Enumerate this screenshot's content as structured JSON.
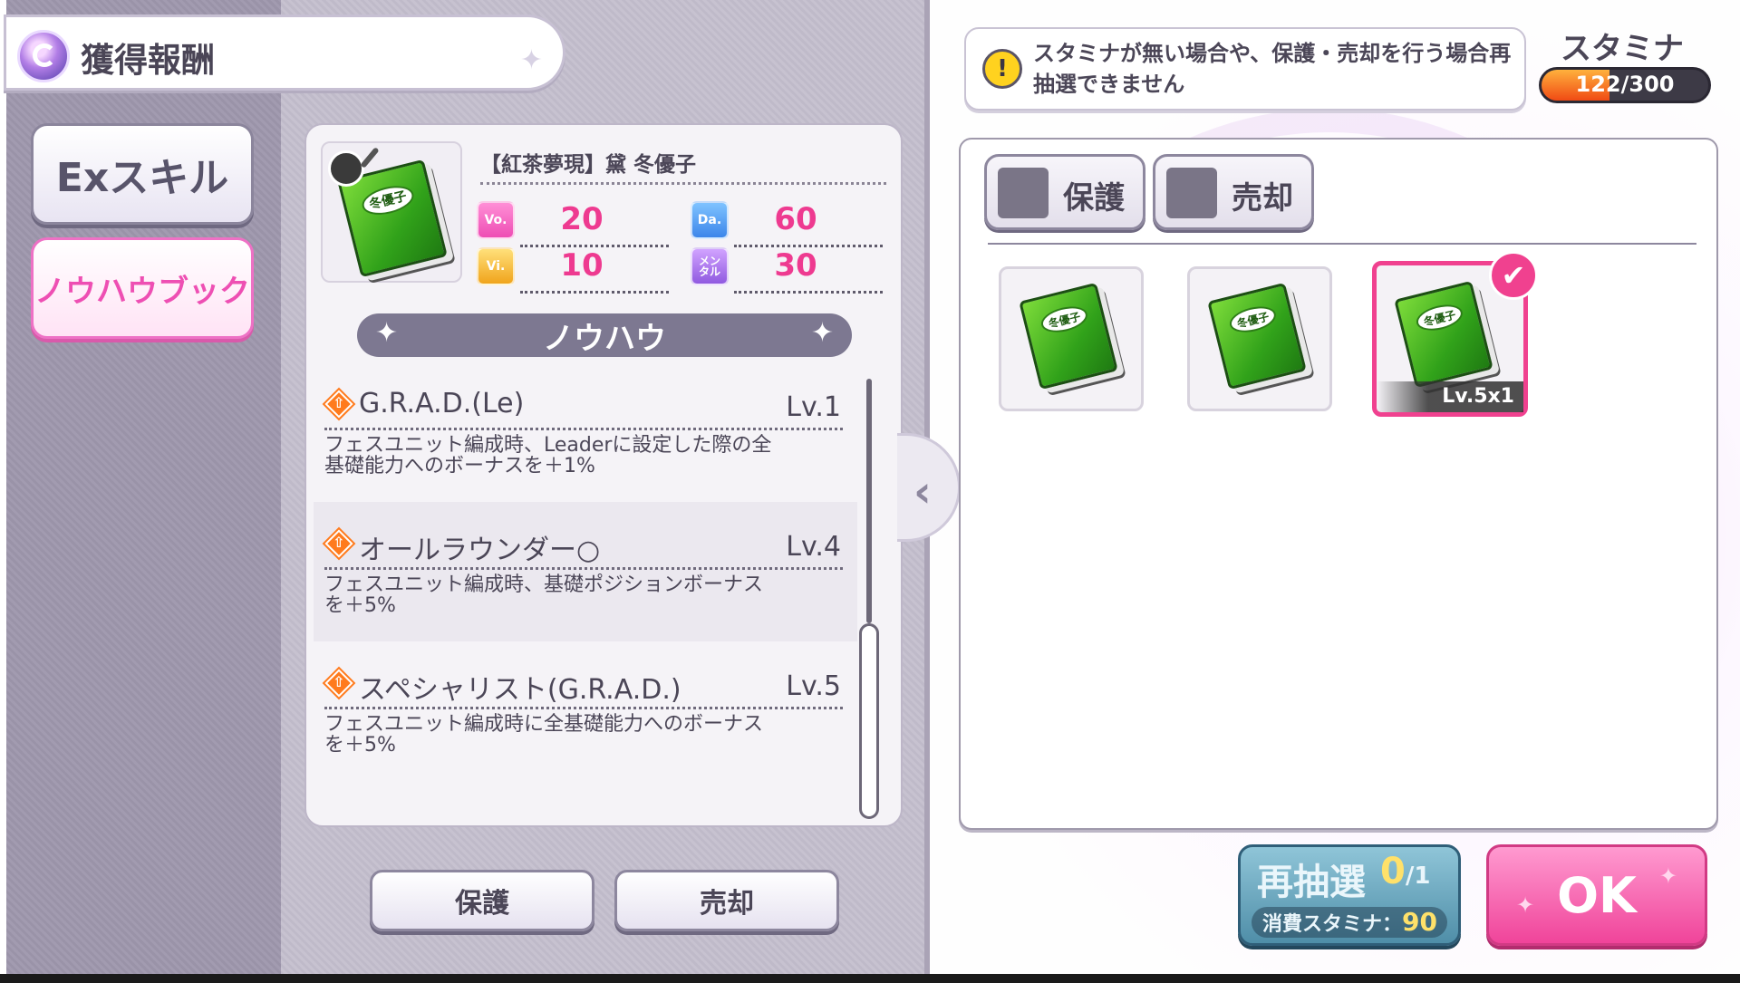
{
  "header": {
    "title": "獲得報酬"
  },
  "side_tabs": [
    {
      "label": "Exスキル",
      "active": false
    },
    {
      "label": "ノウハウブック",
      "active": true
    }
  ],
  "detail": {
    "item_name": "【紅茶夢現】黛 冬優子",
    "book_label": "冬優子",
    "stats": [
      {
        "badge": "Vo.",
        "value": "20",
        "color": "#ee4db4"
      },
      {
        "badge": "Da.",
        "value": "60",
        "color": "#3c86ea"
      },
      {
        "badge": "Vi.",
        "value": "10",
        "color": "#f0a41c"
      },
      {
        "badge": "メン\nタル",
        "value": "30",
        "color": "#9059e0"
      }
    ],
    "section_title": "ノウハウ",
    "knowhows": [
      {
        "name": "G.R.A.D.(Le)",
        "level": "Lv.1",
        "description": "フェスユニット編成時、Leaderに設定した際の全基礎能力へのボーナスを＋1%"
      },
      {
        "name": "オールラウンダー○",
        "level": "Lv.4",
        "description": "フェスユニット編成時、基礎ポジションボーナスを＋5%"
      },
      {
        "name": "スペシャリスト(G.R.A.D.)",
        "level": "Lv.5",
        "description": "フェスユニット編成時に全基礎能力へのボーナスを＋5%"
      }
    ],
    "buttons": {
      "protect": "保護",
      "sell": "売却"
    }
  },
  "notice": {
    "text": "スタミナが無い場合や、保護・売却を行う場合再抽選できません"
  },
  "stamina": {
    "label": "スタミナ",
    "current": 122,
    "max": 300,
    "text": "122/300",
    "fill_fraction": 0.41
  },
  "inventory": {
    "filters": {
      "protect": "保護",
      "sell": "売却"
    },
    "items": [
      {
        "book_label": "冬優子",
        "selected": false
      },
      {
        "book_label": "冬優子",
        "selected": false
      },
      {
        "book_label": "冬優子",
        "selected": true,
        "level_text": "Lv.5x1"
      }
    ],
    "check_mark": "✔"
  },
  "reroll": {
    "title": "再抽選",
    "count": "0",
    "max": "1",
    "cost_label": "消費スタミナ：",
    "cost": "90"
  },
  "ok": {
    "label": "OK"
  },
  "colors": {
    "accent_pink": "#f0418f",
    "stamina_orange": "#f04a14",
    "reroll_blue": "#4f8ea8"
  }
}
